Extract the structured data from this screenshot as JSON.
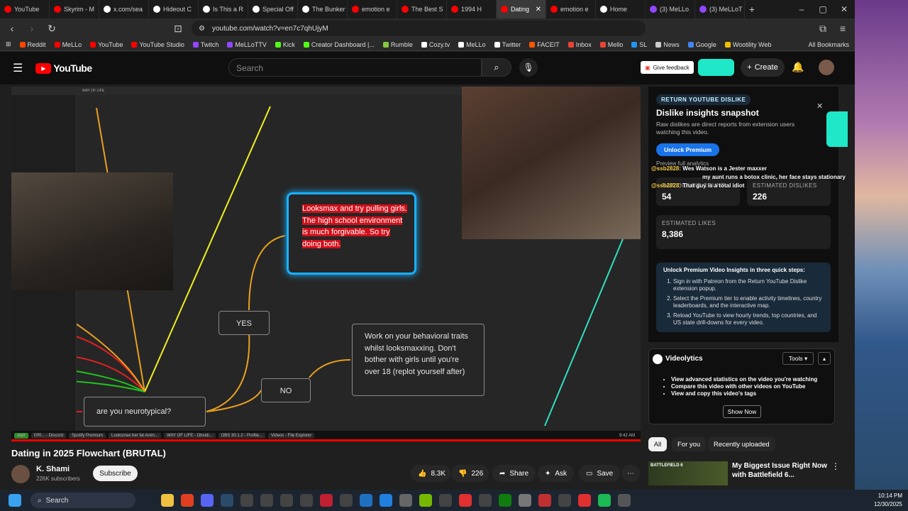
{
  "tabs": [
    {
      "label": "YouTube",
      "color": "#ff0000"
    },
    {
      "label": "Skyrim - M",
      "color": "#ff0000"
    },
    {
      "label": "x.com/sea",
      "color": "#ffffff"
    },
    {
      "label": "Hideout C",
      "color": "#ffffff"
    },
    {
      "label": "Is This a R",
      "color": "#ffffff"
    },
    {
      "label": "Special Off",
      "color": "#ffffff"
    },
    {
      "label": "The Bunker",
      "color": "#ffffff"
    },
    {
      "label": "emotion e",
      "color": "#ff0000"
    },
    {
      "label": "The Best S",
      "color": "#ff0000"
    },
    {
      "label": "1994 H",
      "color": "#ff0000"
    },
    {
      "label": "Dating",
      "color": "#ff0000",
      "active": true
    },
    {
      "label": "emotion e",
      "color": "#ff0000"
    },
    {
      "label": "Home",
      "color": "#ffffff"
    },
    {
      "label": "(3) MeLLo",
      "color": "#9146ff"
    },
    {
      "label": "(3) MeLLoT",
      "color": "#9146ff"
    }
  ],
  "address": {
    "url": "youtube.com/watch?v=en7c7qhUjyM"
  },
  "bookmarks": [
    {
      "label": "Reddit",
      "color": "#ff4500"
    },
    {
      "label": "MeLLo",
      "color": "#ff0000"
    },
    {
      "label": "YouTube",
      "color": "#ff0000"
    },
    {
      "label": "YouTube Studio",
      "color": "#ff0000"
    },
    {
      "label": "Twitch",
      "color": "#9146ff"
    },
    {
      "label": "MeLLoTTV",
      "color": "#9146ff"
    },
    {
      "label": "Kick",
      "color": "#53fc18"
    },
    {
      "label": "Creator Dashboard |...",
      "color": "#53fc18"
    },
    {
      "label": "Rumble",
      "color": "#85c742"
    },
    {
      "label": "Cozy.tv",
      "color": "#ffffff"
    },
    {
      "label": "MeLLo",
      "color": "#ffffff"
    },
    {
      "label": "Twitter",
      "color": "#ffffff"
    },
    {
      "label": "FACEIT",
      "color": "#ff5500"
    },
    {
      "label": "Inbox",
      "color": "#ea4335"
    },
    {
      "label": "Mello",
      "color": "#ea4335"
    },
    {
      "label": "SL",
      "color": "#2196f3"
    },
    {
      "label": "News",
      "color": "#cccccc"
    },
    {
      "label": "Google",
      "color": "#4285f4"
    },
    {
      "label": "Wootility Web",
      "color": "#f0c000"
    }
  ],
  "all_bookmarks": "All Bookmarks",
  "yt": {
    "logo": "YouTube",
    "search_placeholder": "Search",
    "feedback": "Give feedback",
    "create": "Create"
  },
  "video": {
    "caption": "Looksmax and try pulling girls. The high school environment is much forgivable. So try doing both.",
    "node_yes": "YES",
    "node_no": "NO",
    "node_behavior": "Work on your behavioral traits whilst looksmaxxing. Don't bother with girls until you're over 18 (replot yourself after)",
    "node_neuro": "are you neurotypical?",
    "window_title": "WAY OF LIFE",
    "obs_items": [
      "start",
      "GRI... - Discord",
      "Spotify Premium",
      "Looksmax her fat Anim...",
      "WAY OF LIFE - Obsidi...",
      "OBS 30.1.2 - Profile...",
      "Videos - File Explorer"
    ],
    "obs_time": "9:42 AM",
    "title": "Dating in 2025 Flowchart (BRUTAL)"
  },
  "channel": {
    "name": "K. Shami",
    "subs": "226K subscribers",
    "subscribe": "Subscribe"
  },
  "actions": {
    "likes": "8.3K",
    "dislikes": "226",
    "share": "Share",
    "ask": "Ask",
    "save": "Save"
  },
  "ryd": {
    "badge": "RETURN YOUTUBE DISLIKE",
    "title": "Dislike insights snapshot",
    "desc": "Raw dislikes are direct reports from extension users watching this video.",
    "unlock": "Unlock Premium",
    "preview": "Preview full analytics",
    "raw_label": "RAW DISLIKE COUNT",
    "raw_value": "54",
    "est_dis_label": "ESTIMATED DISLIKES",
    "est_dis_value": "226",
    "est_likes_label": "ESTIMATED LIKES",
    "est_likes_value": "8,386",
    "steps_title": "Unlock Premium Video Insights in three quick steps:",
    "steps": [
      "Sign in with Patreon from the Return YouTube Dislike extension popup.",
      "Select the Premium tier to enable activity timelines, country leaderboards, and the interactive map.",
      "Reload YouTube to view hourly trends, top countries, and US state drill-downs for every video."
    ]
  },
  "chat": [
    {
      "name": "@ssb2828:",
      "msg": "Wes Watson is a Jester maxxer"
    },
    {
      "name": "@ssb2828:",
      "msg": "my aunt runs a botox clinic, her face stays stationary"
    },
    {
      "name": "@ssb2828:",
      "msg": "That guy is a total idiot"
    }
  ],
  "videolytics": {
    "title": "Videolytics",
    "tools": "Tools",
    "items": [
      "View advanced statistics on the video you're watching",
      "Compare this video with other videos on YouTube",
      "View and copy this video's tags"
    ],
    "show": "Show Now"
  },
  "chips": [
    "All",
    "For you",
    "Recently uploaded"
  ],
  "rec": {
    "title": "My Biggest Issue Right Now with Battlefield 6...",
    "thumb_text": "BATTLEFIELD 6"
  },
  "taskbar": {
    "search": "Search",
    "time": "10:14 PM",
    "date": "12/30/2025"
  }
}
